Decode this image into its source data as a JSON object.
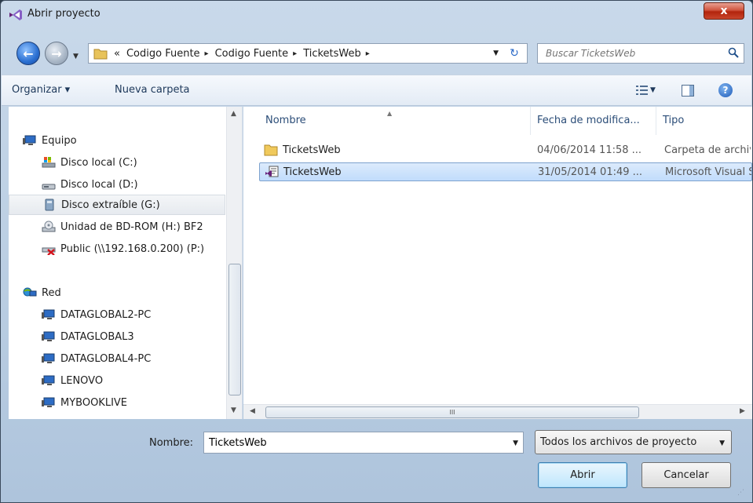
{
  "window": {
    "title": "Abrir proyecto",
    "close_label": "x"
  },
  "nav": {
    "breadcrumbs": [
      "«",
      "Codigo Fuente",
      "▸",
      "Codigo Fuente",
      "▸",
      "TicketsWeb",
      "▸"
    ],
    "search_placeholder": "Buscar TicketsWeb"
  },
  "toolbar": {
    "organize_label": "Organizar ▾",
    "new_folder_label": "Nueva carpeta",
    "help_label": "?"
  },
  "sidebar": {
    "groups": [
      {
        "label": "Equipo",
        "icon": "computer-icon"
      },
      {
        "label": "Disco local (C:)",
        "icon": "drive-os-icon"
      },
      {
        "label": "Disco local (D:)",
        "icon": "drive-icon"
      },
      {
        "label": "Disco extraíble (G:)",
        "icon": "removable-drive-icon",
        "selected": true
      },
      {
        "label": "Unidad de BD-ROM (H:) BF2",
        "icon": "optical-drive-icon"
      },
      {
        "label": "Public (\\\\192.168.0.200) (P:)",
        "icon": "network-drive-disconnected-icon"
      },
      {
        "label": "Red",
        "icon": "network-icon"
      },
      {
        "label": "DATAGLOBAL2-PC",
        "icon": "computer-icon"
      },
      {
        "label": "DATAGLOBAL3",
        "icon": "computer-icon"
      },
      {
        "label": "DATAGLOBAL4-PC",
        "icon": "computer-icon"
      },
      {
        "label": "LENOVO",
        "icon": "computer-icon"
      },
      {
        "label": "MYBOOKLIVE",
        "icon": "computer-icon"
      }
    ]
  },
  "filelist": {
    "columns": [
      "Nombre",
      "Fecha de modifica...",
      "Tipo"
    ],
    "rows": [
      {
        "name": "TicketsWeb",
        "date": "04/06/2014 11:58 ...",
        "type": "Carpeta de archivos",
        "icon": "folder-icon"
      },
      {
        "name": "TicketsWeb",
        "date": "31/05/2014 01:49 ...",
        "type": "Microsoft Visual Studio Solution",
        "icon": "vs-solution-icon",
        "selected": true
      }
    ],
    "hscroll_grip": "III"
  },
  "footer": {
    "name_label": "Nombre:",
    "name_value": "TicketsWeb",
    "filter_value": "Todos los archivos de proyecto",
    "open_label": "Abrir",
    "cancel_label": "Cancelar"
  },
  "colors": {
    "accent": "#3c7fb1",
    "selection": "#c1dcfc",
    "titlebar": "#b9cde2",
    "close": "#c8452c"
  }
}
